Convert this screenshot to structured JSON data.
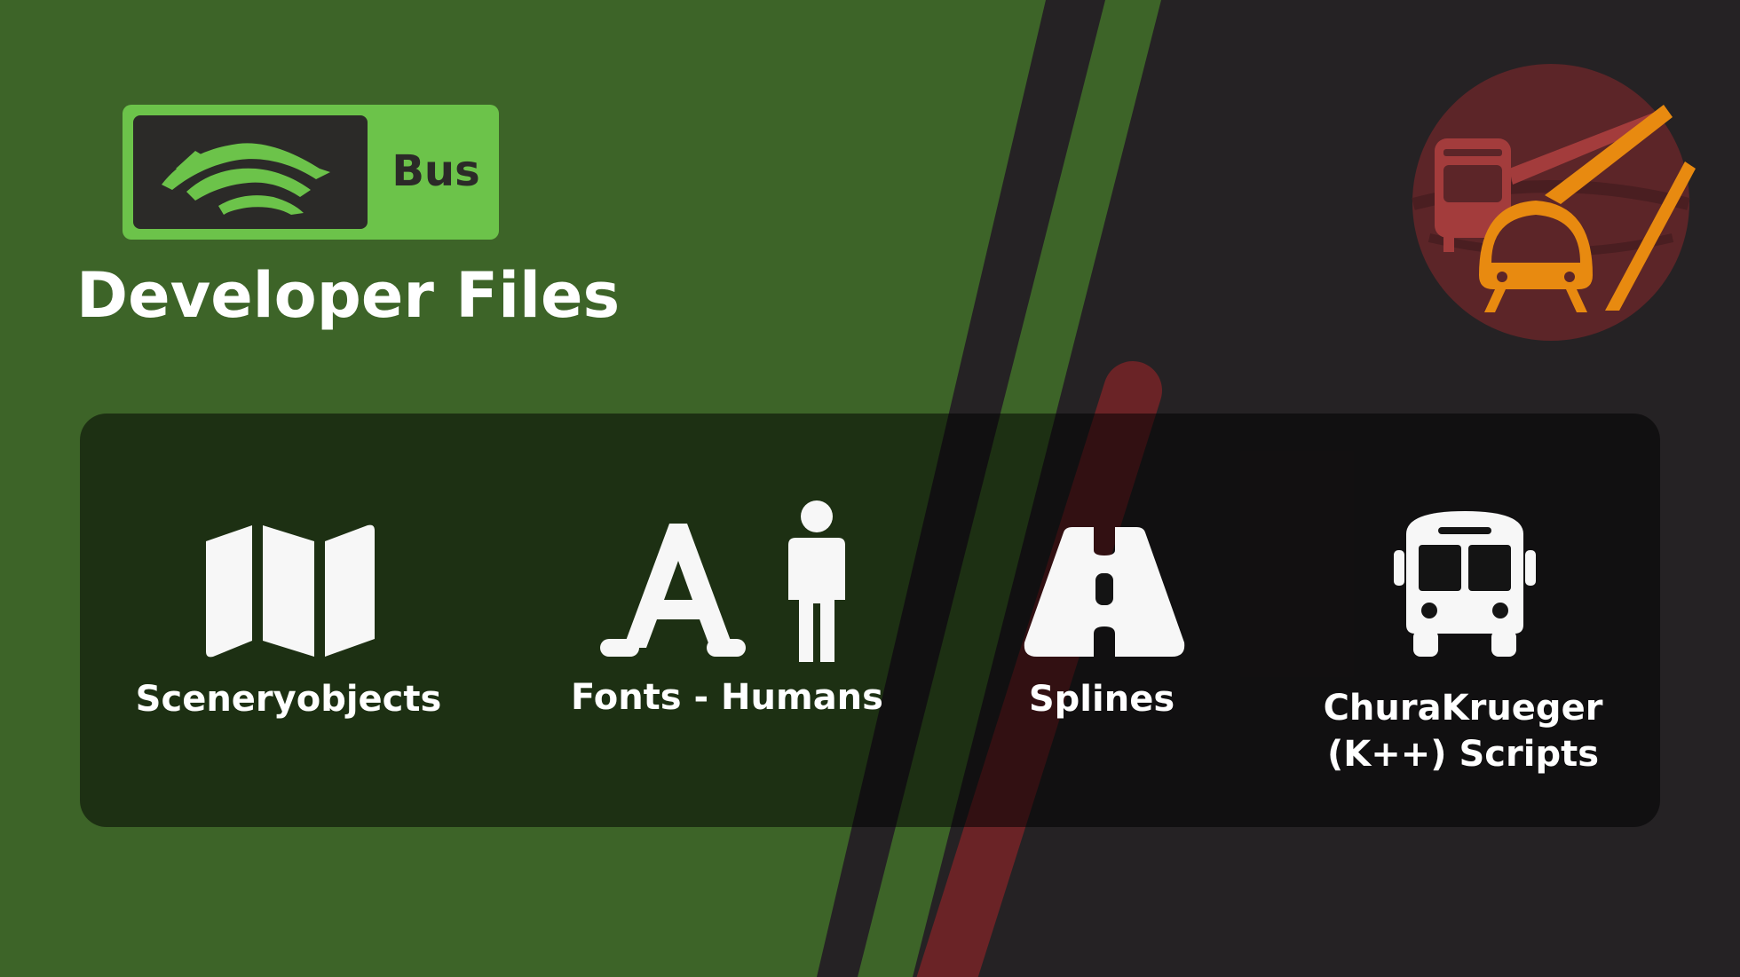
{
  "header": {
    "logo_word": "Bus",
    "logo_icon": "leaf-waves-icon",
    "title": "Developer Files"
  },
  "emblem": {
    "icon": "bus-and-tram-icon"
  },
  "items": [
    {
      "label": "Sceneryobjects",
      "icon": "folded-map-icon"
    },
    {
      "label": "Fonts - Humans",
      "icon": "font-letter-and-person-icon"
    },
    {
      "label": "Splines",
      "icon": "road-icon"
    },
    {
      "label": "ChuraKrueger (K++) Scripts",
      "icon": "bus-icon"
    }
  ],
  "colors": {
    "green_background": "#3d6428",
    "dark_background": "#252224",
    "logo_green": "#6cc34a",
    "emblem_circle": "#5c2528",
    "emblem_bus": "#a33c3c",
    "emblem_tram": "#e88a10",
    "stripe_red": "#6a2326"
  }
}
